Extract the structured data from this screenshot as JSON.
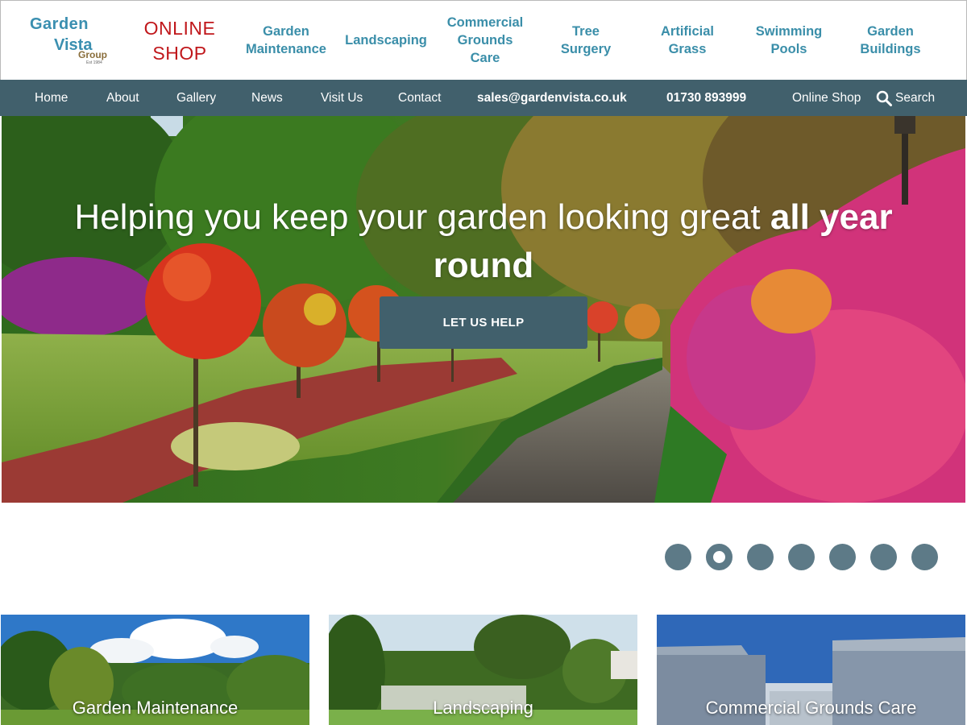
{
  "logo": {
    "line1": "Garden",
    "line2": "Vista",
    "line3": "Group",
    "est": "Est 1984"
  },
  "header": {
    "online_shop_line1": "ONLINE",
    "online_shop_line2": "SHOP",
    "services": [
      "Garden\nMaintenance",
      "Landscaping",
      "Commercial\nGrounds\nCare",
      "Tree\nSurgery",
      "Artificial\nGrass",
      "Swimming\nPools",
      "Garden\nBuildings"
    ]
  },
  "nav": {
    "items": [
      "Home",
      "About",
      "Gallery",
      "News",
      "Visit Us",
      "Contact"
    ],
    "email": "sales@gardenvista.co.uk",
    "phone": "01730 893999",
    "online_shop": "Online Shop",
    "search": "Search"
  },
  "hero": {
    "title_regular": "Helping you keep your garden looking great ",
    "title_bold": "all year round",
    "cta": "LET US HELP"
  },
  "slider": {
    "count": 7,
    "active_index": 1
  },
  "cards": [
    "Garden Maintenance",
    "Landscaping",
    "Commercial Grounds Care"
  ],
  "colors": {
    "brand_teal": "#3a8ea9",
    "nav_bg": "#41606c",
    "shop_red": "#c0171b",
    "dot": "#5d7a87"
  },
  "icons": {
    "search": "search-icon"
  }
}
